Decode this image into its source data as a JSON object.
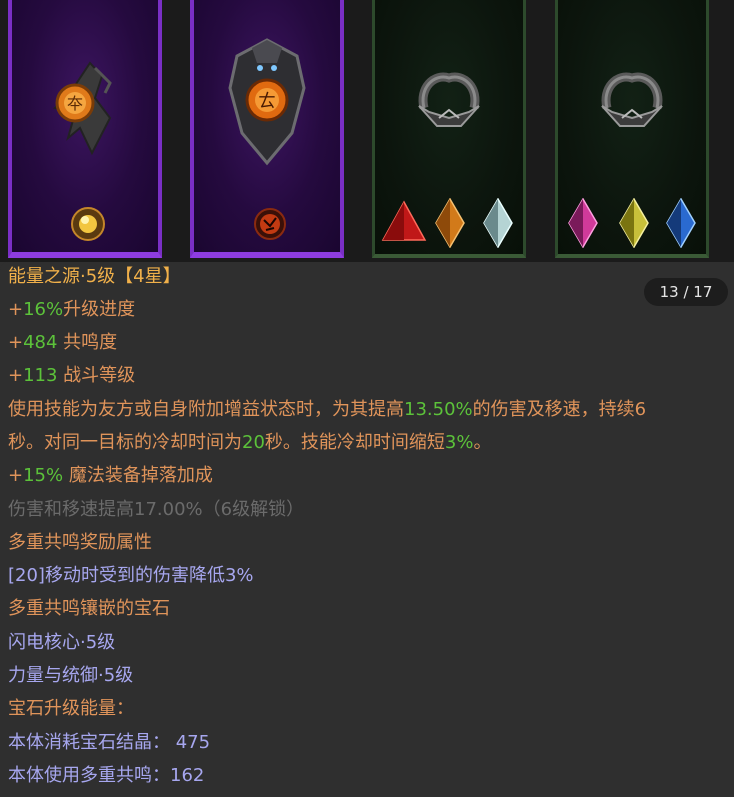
{
  "item": {
    "title": "能量之源·5级【4星】",
    "counter": "13 / 17"
  },
  "stats": [
    {
      "prefix": "+",
      "value": "16%",
      "label": "升级进度"
    },
    {
      "prefix": "+",
      "value": "484",
      "label": " 共鸣度"
    },
    {
      "prefix": "+",
      "value": "113",
      "label": " 战斗等级"
    }
  ],
  "description": {
    "part1": "使用技能为友方或自身附加增益状态时，为其提高",
    "v1": "13.50%",
    "part2": "的伤害及移速，持续6",
    "part3": "秒。对同一目标的冷却时间为",
    "v2": "20",
    "part4": "秒。技能冷却时间缩短",
    "v3": "3%",
    "part5": "。"
  },
  "magic_find": {
    "prefix": "+",
    "value": "15%",
    "label": " 魔法装备掉落加成"
  },
  "locked_bonus": "伤害和移速提高17.00%（6级解锁）",
  "resonance_header": "多重共鸣奖励属性",
  "resonance_bonus": "[20]移动时受到的伤害降低3%",
  "socket_header": "多重共鸣镶嵌的宝石",
  "gems": [
    "闪电核心·5级",
    "力量与统御·5级"
  ],
  "upgrade_header": "宝石升级能量：",
  "energy": [
    {
      "label": "本体消耗宝石结晶：",
      "value": "475"
    },
    {
      "label": "本体使用多重共鸣：",
      "value": "162"
    }
  ],
  "cards": [
    {
      "name": "charm-card",
      "rarity": "legendary",
      "icon": "amulet-charm-icon",
      "gem": "orange-orb-icon"
    },
    {
      "name": "shield-card",
      "rarity": "legendary",
      "icon": "shield-charm-icon",
      "gem": "red-orb-icon"
    },
    {
      "name": "ring-card-1",
      "rarity": "set",
      "icon": "ring-icon",
      "gems": [
        "red-triangle-gem-icon",
        "orange-marquise-gem-icon",
        "white-marquise-gem-icon"
      ]
    },
    {
      "name": "ring-card-2",
      "rarity": "set",
      "icon": "ring-icon",
      "gems": [
        "pink-marquise-gem-icon",
        "yellow-marquise-gem-icon",
        "blue-marquise-gem-icon"
      ]
    }
  ],
  "colors": {
    "panel_bg": "#2f2f2f",
    "title": "#f0b04a",
    "text": "#e0945a",
    "value": "#5cc23a",
    "muted": "#6b6b6b",
    "blue": "#a7a7ef",
    "legendary_border": "#8e3ce0"
  }
}
